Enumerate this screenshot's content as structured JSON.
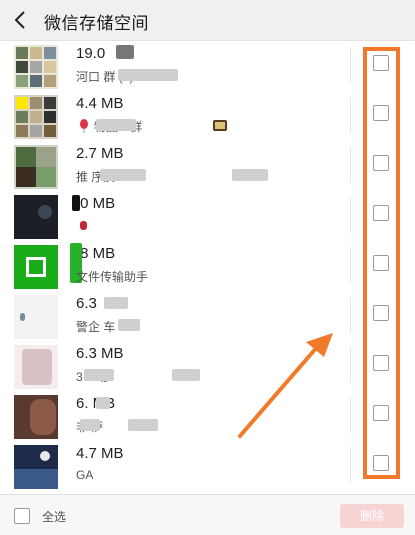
{
  "header": {
    "title": "微信存储空间"
  },
  "rows": [
    {
      "size": "19.0",
      "name": "河口        群 (1)"
    },
    {
      "size": "4.4 MB",
      "name": "    物品一群"
    },
    {
      "size": "2.7 MB",
      "name": "    推    序质"
    },
    {
      "size": ".0 MB",
      "name": ""
    },
    {
      "size": ".8 MB",
      "name": "文件传输助手"
    },
    {
      "size": "6.3",
      "name": "警企    车"
    },
    {
      "size": "6.3 MB",
      "name": "3        2    动"
    },
    {
      "size": "6.  MB",
      "name": "    非    萨"
    },
    {
      "size": "4.7 MB",
      "name": "GA"
    }
  ],
  "footer": {
    "select_all": "全选",
    "delete": "删除"
  },
  "colors": {
    "highlight": "#f07a2a",
    "delete_bg": "#f8d3d3",
    "wechat_green": "#1aad19"
  }
}
